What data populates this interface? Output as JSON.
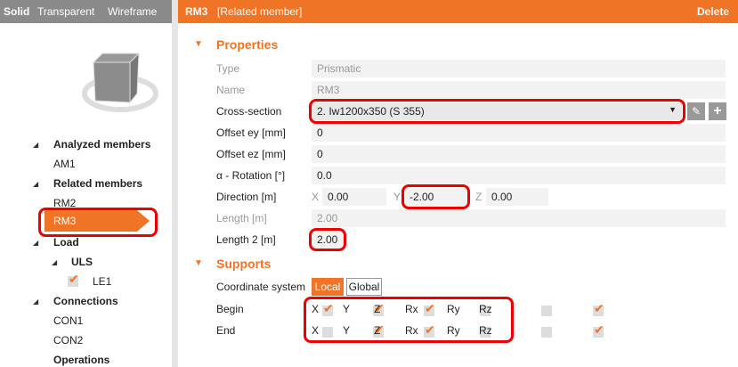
{
  "view_modes": [
    "Solid",
    "Transparent",
    "Wireframe"
  ],
  "header": {
    "title": "RM3",
    "subtitle": "[Related member]",
    "delete": "Delete"
  },
  "tree": {
    "analyzed": "Analyzed members",
    "am1": "AM1",
    "related": "Related members",
    "rm2": "RM2",
    "rm3": "RM3",
    "load": "Load",
    "uls": "ULS",
    "le1": "LE1",
    "connections": "Connections",
    "con1": "CON1",
    "con2": "CON2",
    "operations": "Operations"
  },
  "properties": {
    "title": "Properties",
    "type_label": "Type",
    "type_value": "Prismatic",
    "name_label": "Name",
    "name_value": "RM3",
    "cs_label": "Cross-section",
    "cs_value": "2. Iw1200x350 (S 355)",
    "ey_label": "Offset ey [mm]",
    "ey_value": "0",
    "ez_label": "Offset ez [mm]",
    "ez_value": "0",
    "rot_label": "α - Rotation [°]",
    "rot_value": "0.0",
    "dir_label": "Direction [m]",
    "dir_x": "0.00",
    "dir_y": "-2.00",
    "dir_z": "0.00",
    "x": "X",
    "y": "Y",
    "z": "Z",
    "len_label": "Length [m]",
    "len_value": "2.00",
    "len2_label": "Length 2 [m]",
    "len2_value": "2.00"
  },
  "supports": {
    "title": "Supports",
    "cs_label": "Coordinate system",
    "local": "Local",
    "global": "Global",
    "begin_label": "Begin",
    "end_label": "End",
    "dofs": [
      "X",
      "Y",
      "Z",
      "Rx",
      "Ry",
      "Rz"
    ],
    "begin": [
      true,
      true,
      true,
      false,
      false,
      true
    ],
    "end": [
      false,
      true,
      true,
      false,
      false,
      true
    ]
  }
}
